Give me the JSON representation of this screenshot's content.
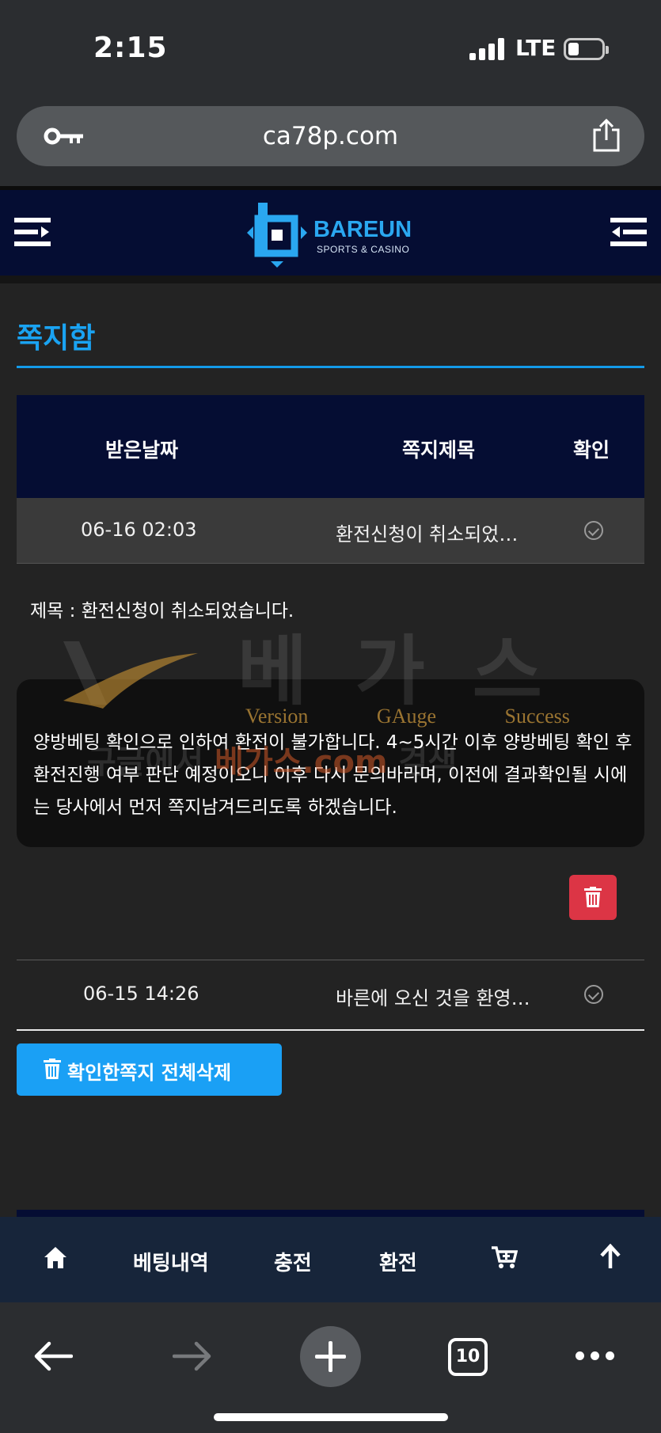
{
  "status_bar": {
    "time": "2:15",
    "network": "LTE"
  },
  "browser": {
    "url": "ca78p.com",
    "tab_count": "10"
  },
  "site": {
    "brand_name": "BAREUN",
    "brand_sub": "SPORTS & CASINO"
  },
  "page": {
    "title": "쪽지함"
  },
  "table": {
    "columns": [
      "받은날짜",
      "쪽지제목",
      "확인"
    ],
    "rows": [
      {
        "date": "06-16 02:03",
        "subject": "환전신청이 취소되었…",
        "read": true
      },
      {
        "date": "06-15 14:26",
        "subject": "바른에 오신 것을 환영…",
        "read": true
      }
    ]
  },
  "message": {
    "title": "제목 : 환전신청이 취소되었습니다.",
    "body": "양방베팅 확인으로 인하여 환전이 불가합니다. 4~5시간 이후 양방베팅 확인 후 환전진행 여부 판단 예정이오니 이후 다시 문의바라며, 이전에 결과확인될 시에는 당사에서 먼저 쪽지남겨드리도록 하겠습니다."
  },
  "watermark": {
    "big": "베가스",
    "words": "Version GAuge Success",
    "search_prefix": "구글에서 ",
    "search_site": "베가스.com",
    "search_suffix": " 검색"
  },
  "actions": {
    "delete_all": "확인한쪽지 전체삭제"
  },
  "bottom_nav": {
    "betting_history": "베팅내역",
    "deposit": "충전",
    "withdraw": "환전"
  },
  "icons": [
    "key-icon",
    "share-icon",
    "menu-icon",
    "check-circle-icon",
    "trash-icon",
    "home-icon",
    "cart-icon",
    "arrow-up-icon",
    "back-arrow-icon",
    "forward-arrow-icon",
    "plus-icon",
    "more-icon"
  ],
  "colors": {
    "accent": "#1aa3f2",
    "header_bg": "#050d33",
    "delete": "#dc3545",
    "page_bg": "#232323"
  }
}
